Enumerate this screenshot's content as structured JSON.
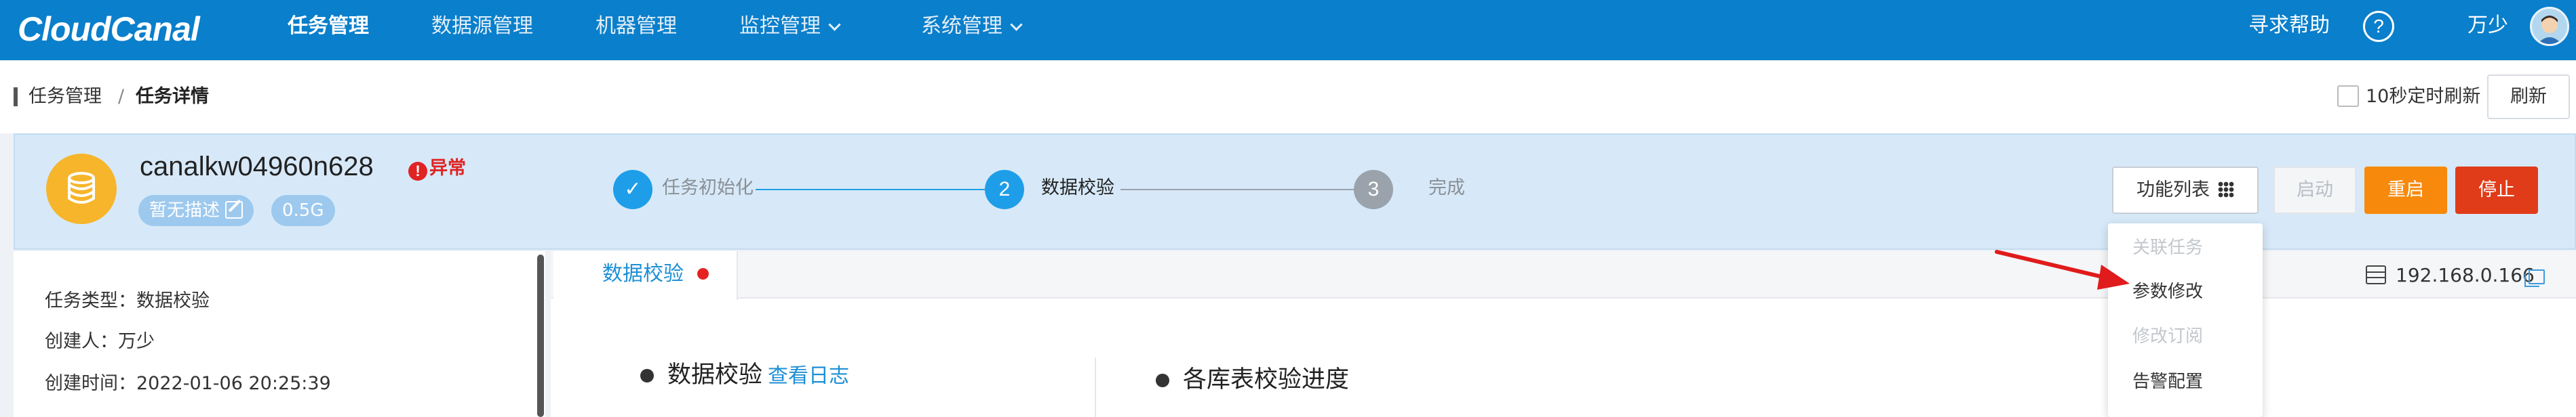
{
  "nav": {
    "logo": "CloudCanal",
    "items": [
      {
        "label": "任务管理"
      },
      {
        "label": "数据源管理"
      },
      {
        "label": "机器管理"
      },
      {
        "label": "监控管理"
      },
      {
        "label": "系统管理"
      }
    ],
    "help": "寻求帮助",
    "help_icon": "?",
    "user": "万少"
  },
  "breadcrumb": {
    "root": "任务管理",
    "separator": "/",
    "current": "任务详情"
  },
  "auto_refresh": {
    "label": "10秒定时刷新",
    "checked": false
  },
  "refresh_button": "刷新",
  "task": {
    "name": "canalkw04960n628",
    "status_icon": "!",
    "status": "异常",
    "description_tag": "暂无描述",
    "spec_tag": "0.5G"
  },
  "steps": [
    {
      "number": "✓",
      "label": "任务初始化",
      "state": "done"
    },
    {
      "number": "2",
      "label": "数据校验",
      "state": "active"
    },
    {
      "number": "3",
      "label": "完成",
      "state": "pending"
    }
  ],
  "actions": {
    "function_list": "功能列表",
    "start": "启动",
    "restart": "重启",
    "stop": "停止"
  },
  "function_menu": [
    {
      "label": "关联任务",
      "disabled": true
    },
    {
      "label": "参数修改",
      "disabled": false
    },
    {
      "label": "修改订阅",
      "disabled": true
    },
    {
      "label": "告警配置",
      "disabled": false
    }
  ],
  "info": {
    "task_type": "任务类型：数据校验",
    "creator": "创建人：万少",
    "created_at": "创建时间：2022-01-06 20:25:39"
  },
  "tab": {
    "label": "数据校验"
  },
  "server": {
    "ip": "192.168.0.166"
  },
  "sections": {
    "check_title": "数据校验",
    "check_link": "查看日志",
    "progress_title": "各库表校验进度"
  },
  "colors": {
    "nav_bg": "#0a7fcb",
    "accent": "#1e8fd6",
    "restart": "#f7890c",
    "stop": "#e03c1a",
    "error": "#e02424"
  }
}
